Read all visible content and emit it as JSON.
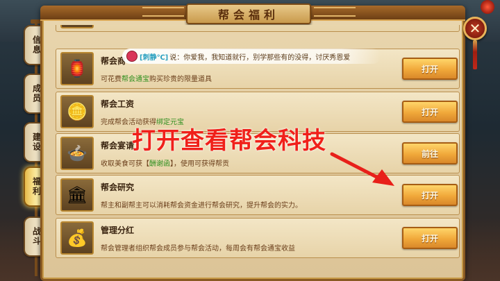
{
  "panel": {
    "title": "帮会福利",
    "close_glyph": "✕"
  },
  "tabs": [
    {
      "label": "信息",
      "active": false
    },
    {
      "label": "成员",
      "active": false
    },
    {
      "label": "建设",
      "active": false
    },
    {
      "label": "福利",
      "active": true
    },
    {
      "label": "战斗",
      "active": false
    }
  ],
  "chat": {
    "name": "[刺静℃]",
    "message": "说：你爱我，我知道就行，别学那些有的没得，讨厌秀恩爱"
  },
  "items": [
    {
      "title": "帮会商",
      "desc_prefix": "可花费",
      "desc_highlight": "帮会通宝",
      "desc_suffix": "购买珍贵的限量道具",
      "button": "打开",
      "icon": "shop-icon"
    },
    {
      "title": "帮会工资",
      "desc_prefix": "完成帮会活动获得",
      "desc_highlight": "绑定元宝",
      "desc_suffix": "",
      "button": "打开",
      "icon": "coins-icon"
    },
    {
      "title": "帮会宴请",
      "desc_prefix": "收取美食可获【",
      "desc_highlight": "酬谢函",
      "desc_suffix": "】，使用可获得帮贡",
      "button": "前往",
      "icon": "banquet-icon"
    },
    {
      "title": "帮会研究",
      "desc_prefix": "帮主和副帮主可以消耗帮会资金进行帮会研究，提升帮会的实力。",
      "desc_highlight": "",
      "desc_suffix": "",
      "button": "打开",
      "icon": "research-icon"
    },
    {
      "title": "管理分红",
      "desc_prefix": "帮会管理者组织帮会成员参与帮会活动，每周会有帮会通宝收益",
      "desc_highlight": "",
      "desc_suffix": "",
      "button": "打开",
      "icon": "gold-ingot-icon"
    }
  ],
  "annotation": {
    "text": "打开查看帮会科技",
    "color": "#f0201a"
  },
  "colors": {
    "highlight_text": "#2f8f1f",
    "button_orange": "#f0a83a",
    "frame_brown": "#8a5a22"
  }
}
